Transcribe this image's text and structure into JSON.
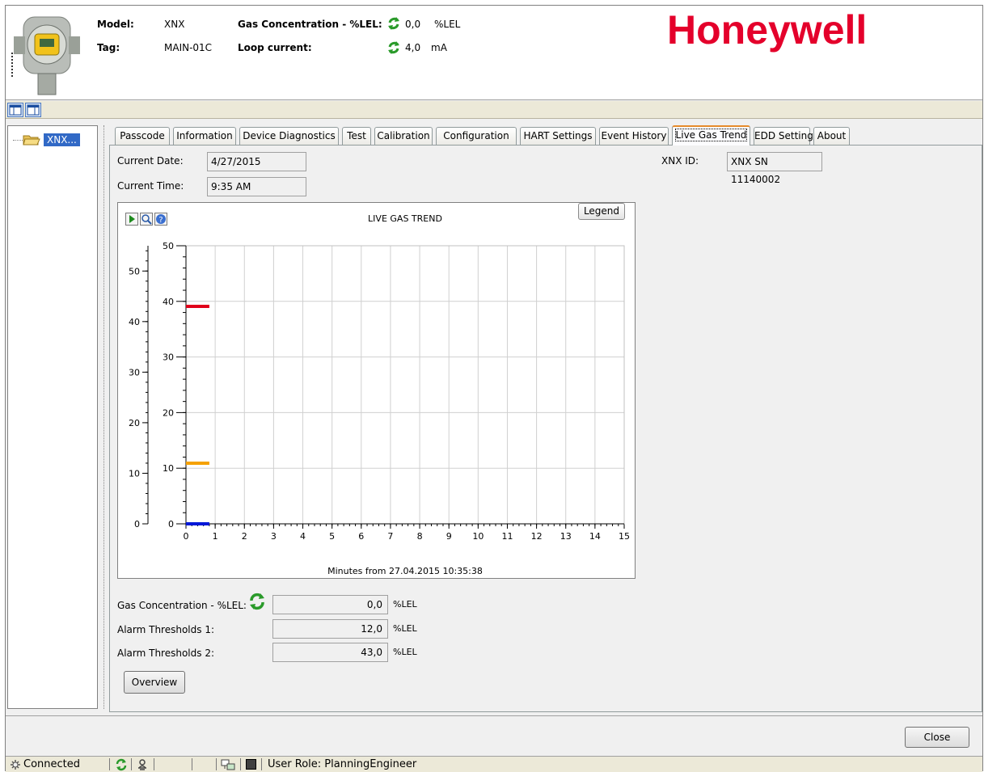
{
  "header": {
    "model_label": "Model:",
    "model_value": "XNX",
    "tag_label": "Tag:",
    "tag_value": "MAIN-01C",
    "gas_label": "Gas Concentration - %LEL:",
    "gas_value": "0,0",
    "gas_unit": "%LEL",
    "loop_label": "Loop current:",
    "loop_value": "4,0",
    "loop_unit": "mA",
    "logo": "Honeywell"
  },
  "colors": {
    "brand": "#e4002b",
    "alarm_high": "#e0001a",
    "alarm_low": "#f5a100",
    "gas": "#0018d8",
    "selection": "#3169c6"
  },
  "tree": {
    "item_label": "XNX..."
  },
  "tabs": [
    {
      "label": "Passcode"
    },
    {
      "label": "Information"
    },
    {
      "label": "Device Diagnostics"
    },
    {
      "label": "Test"
    },
    {
      "label": "Calibration"
    },
    {
      "label": "Configuration"
    },
    {
      "label": "HART Settings"
    },
    {
      "label": "Event History"
    },
    {
      "label": "Live Gas Trend",
      "active": true
    },
    {
      "label": "EDD Settings"
    },
    {
      "label": "About"
    }
  ],
  "panel": {
    "date_label": "Current Date:",
    "date_value": "4/27/2015",
    "time_label": "Current Time:",
    "time_value": "9:35 AM",
    "xnx_id_label": "XNX ID:",
    "xnx_id_value": "XNX SN 11140002",
    "legend_button": "Legend",
    "gas_conc_label": "Gas Concentration - %LEL:",
    "gas_conc_value": "0,0",
    "gas_conc_unit": "%LEL",
    "alarm1_label": "Alarm Thresholds 1:",
    "alarm1_value": "12,0",
    "alarm1_unit": "%LEL",
    "alarm2_label": "Alarm Thresholds 2:",
    "alarm2_value": "43,0",
    "alarm2_unit": "%LEL",
    "overview_button": "Overview"
  },
  "chart_data": {
    "type": "line",
    "title": "LIVE GAS TREND",
    "xlabel": "Minutes from 27.04.2015 10:35:38",
    "x_ticks": [
      "0",
      "1",
      "2",
      "3",
      "4",
      "5",
      "6",
      "7",
      "8",
      "9",
      "10",
      "11",
      "12",
      "13",
      "14",
      "15"
    ],
    "xlim": [
      0,
      15
    ],
    "ylim_outer": [
      0,
      55
    ],
    "y_ticks_outer": [
      "0",
      "10",
      "20",
      "30",
      "40",
      "50"
    ],
    "ylim_inner": [
      0,
      50
    ],
    "y_ticks_inner": [
      "0",
      "10",
      "20",
      "30",
      "40",
      "50"
    ],
    "grid": true,
    "series": [
      {
        "color": "#e0001a",
        "axis": "outer",
        "x": [
          0,
          0.8
        ],
        "y": [
          43,
          43
        ]
      },
      {
        "color": "#f5a100",
        "axis": "outer",
        "x": [
          0,
          0.8
        ],
        "y": [
          12,
          12
        ]
      },
      {
        "color": "#0018d8",
        "axis": "outer",
        "x": [
          0,
          0.8
        ],
        "y": [
          0,
          0
        ]
      }
    ]
  },
  "footer": {
    "close_button": "Close"
  },
  "status": {
    "connection": "Connected",
    "user_role": "User Role: PlanningEngineer"
  }
}
